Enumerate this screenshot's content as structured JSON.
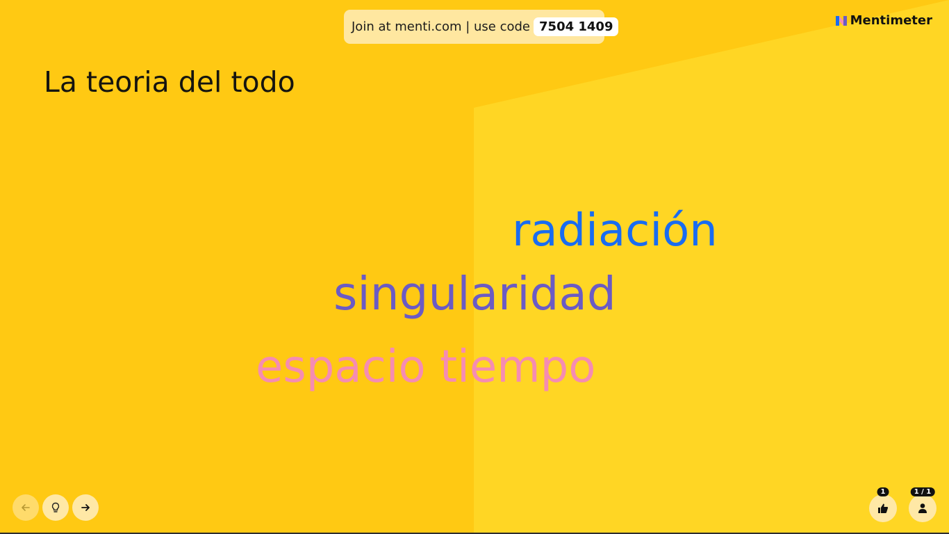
{
  "header": {
    "join_text": "Join at menti.com | use code",
    "join_code": "7504 1409",
    "brand_name": "Mentimeter"
  },
  "slide": {
    "title": "La teoria del todo",
    "words": [
      {
        "text": "radiación",
        "color": "#196CF1"
      },
      {
        "text": "singularidad",
        "color": "#6B5BC4"
      },
      {
        "text": "espacio tiempo",
        "color": "#F58CB2"
      }
    ]
  },
  "controls": {
    "prev_icon": "arrow-left-icon",
    "hint_icon": "lightbulb-icon",
    "next_icon": "arrow-right-icon"
  },
  "stats": {
    "likes_count": "1",
    "participants": "1 / 1"
  },
  "colors": {
    "background": "#FFC913",
    "background_light": "#FFD624",
    "pill": "#FFE7A0"
  }
}
